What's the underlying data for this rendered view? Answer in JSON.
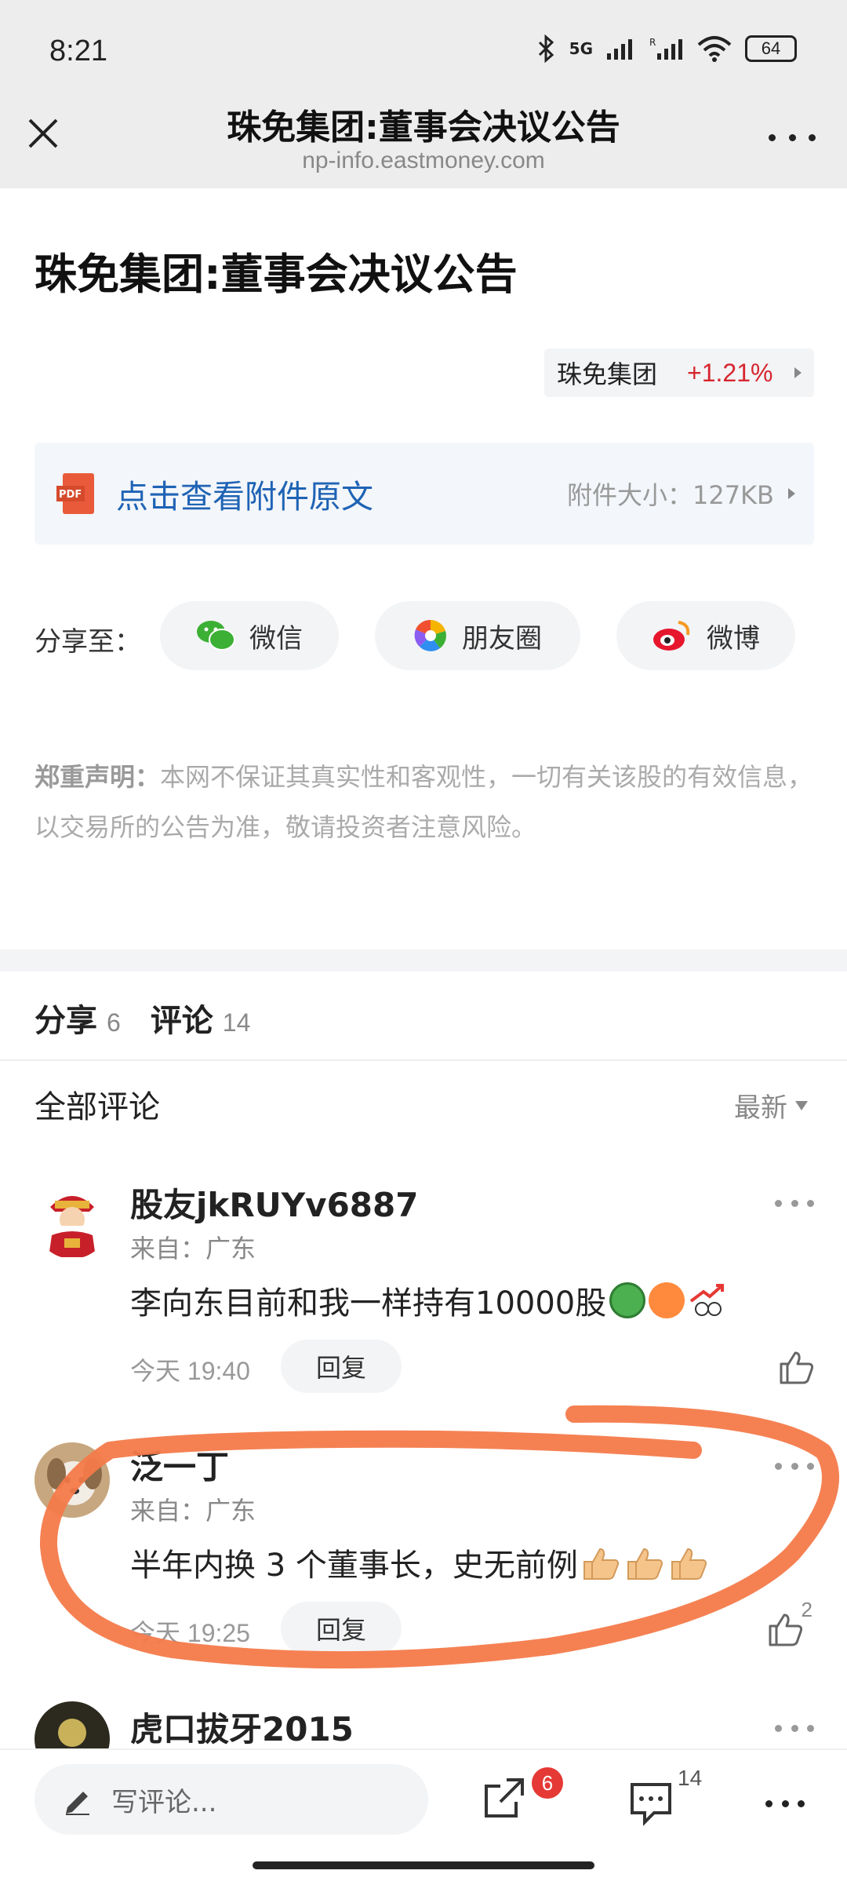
{
  "status_bar": {
    "time": "8:21",
    "network": "5G",
    "battery": "64"
  },
  "nav": {
    "title": "珠免集团:董事会决议公告",
    "url": "np-info.eastmoney.com"
  },
  "article": {
    "title": "珠免集团:董事会决议公告",
    "stock": {
      "name": "珠免集团",
      "change": "+1.21%"
    },
    "attachment": {
      "label": "点击查看附件原文",
      "size_label": "附件大小：127KB"
    },
    "share": {
      "label": "分享至：",
      "wechat": "微信",
      "moments": "朋友圈",
      "weibo": "微博"
    },
    "disclaimer": {
      "bold": "郑重声明：",
      "text": "本网不保证其真实性和客观性，一切有关该股的有效信息，以交易所的公告为准，敬请投资者注意风险。"
    }
  },
  "tabs": {
    "share_label": "分享",
    "share_count": "6",
    "comment_label": "评论",
    "comment_count": "14"
  },
  "comments_header": {
    "title": "全部评论",
    "sort": "最新"
  },
  "comments": [
    {
      "name": "股友jkRUYv6887",
      "from": "来自：广东",
      "text": "李向东目前和我一样持有10000股",
      "time": "今天 19:40",
      "reply": "回复",
      "likes": ""
    },
    {
      "name": "泛一丁",
      "from": "来自：广东",
      "text": "半年内换 3 个董事长，史无前例",
      "time": "今天 19:25",
      "reply": "回复",
      "likes": "2"
    },
    {
      "name": "虎口拔牙2015"
    }
  ],
  "bottom_bar": {
    "placeholder": "写评论...",
    "share_badge": "6",
    "comment_count": "14"
  },
  "colors": {
    "accent_blue": "#1f63b5",
    "rise_red": "#d6262f",
    "annotation_orange": "#f47a4a"
  }
}
